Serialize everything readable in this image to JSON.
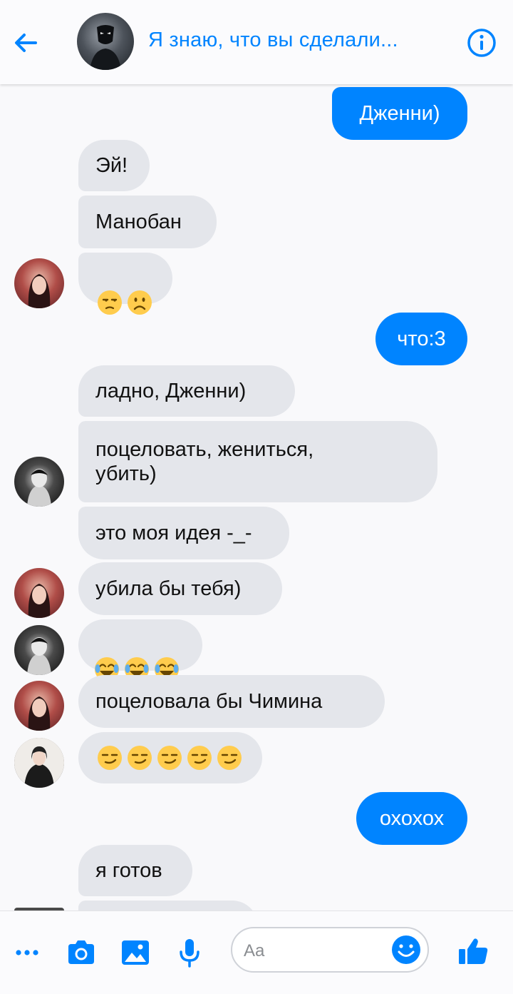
{
  "header": {
    "title": "Я знаю, что вы сделали...",
    "back_icon": "arrow-left-icon",
    "info_icon": "info-icon",
    "accent": "#0084ff"
  },
  "messages": [
    {
      "sender": "me",
      "text": "Дженни)"
    },
    {
      "sender": "jennie",
      "text": "Эй!"
    },
    {
      "sender": "jennie",
      "text": "Манобан"
    },
    {
      "sender": "jennie",
      "emoji": [
        "unamused",
        "frowning"
      ]
    },
    {
      "sender": "me",
      "text": "что:3"
    },
    {
      "sender": "jimin",
      "text": "ладно, Дженни)"
    },
    {
      "sender": "jimin",
      "text": "поцеловать, жениться,\nубить)"
    },
    {
      "sender": "jimin",
      "text": "это моя идея -_-"
    },
    {
      "sender": "jennie",
      "text": "убила бы тебя)"
    },
    {
      "sender": "jimin",
      "emoji": [
        "joy",
        "joy",
        "joy"
      ]
    },
    {
      "sender": "jennie",
      "text": "поцеловала бы Чимина"
    },
    {
      "sender": "girl",
      "emoji": [
        "smirk",
        "smirk",
        "smirk",
        "smirk",
        "smirk"
      ]
    },
    {
      "sender": "me",
      "text": "охохох"
    },
    {
      "sender": "other",
      "text": "я готов"
    }
  ],
  "composer": {
    "placeholder": "Aa",
    "icons": [
      "more-icon",
      "camera-icon",
      "image-icon",
      "microphone-icon",
      "emoji-icon",
      "thumbs-up-icon"
    ]
  },
  "colors": {
    "outgoing_bubble": "#0084ff",
    "incoming_bubble": "#e4e6eb"
  }
}
